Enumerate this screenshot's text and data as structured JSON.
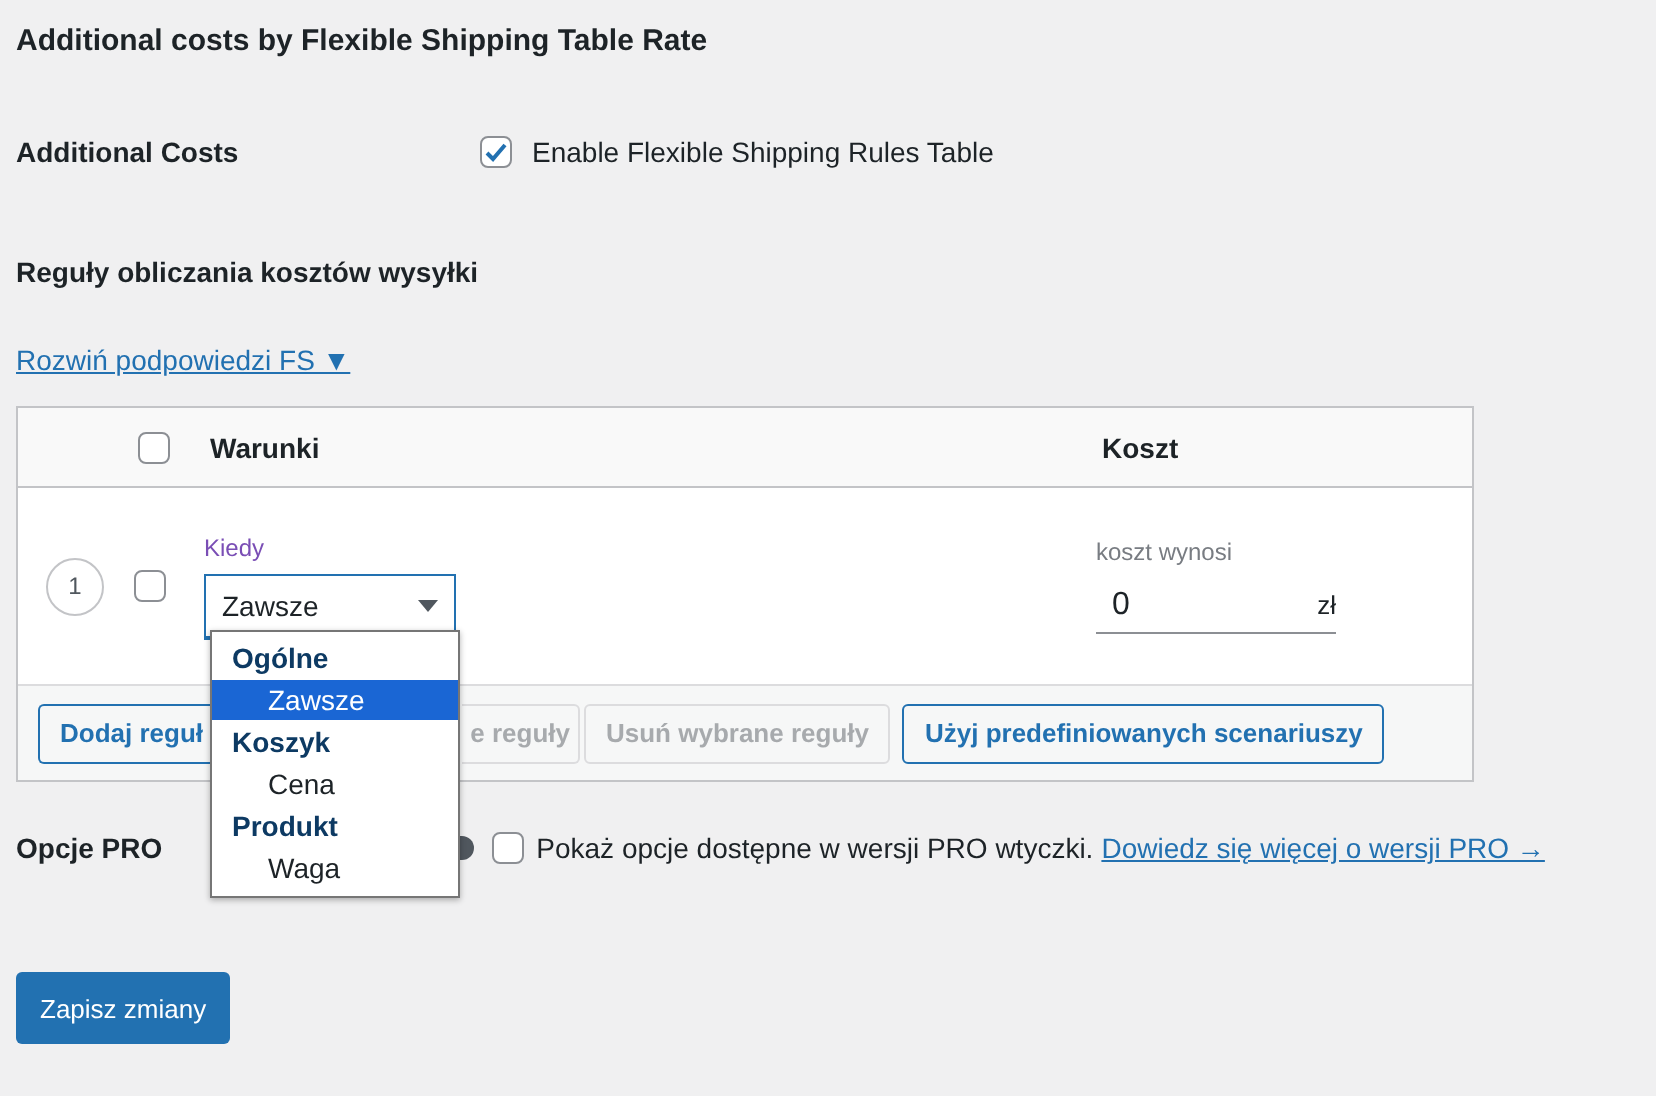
{
  "title": "Additional costs by Flexible Shipping Table Rate",
  "additional_costs": {
    "label": "Additional Costs",
    "checkbox": {
      "label": "Enable Flexible Shipping Rules Table",
      "checked": true
    }
  },
  "rules_heading": "Reguły obliczania kosztów wysyłki",
  "hints_link": "Rozwiń podpowiedzi FS ▼",
  "table": {
    "header_checked": false,
    "columns": [
      "Warunki",
      "Koszt"
    ],
    "rows": [
      {
        "number": "1",
        "checked": false,
        "condition_label": "Kiedy",
        "condition_value": "Zawsze",
        "cost_label": "koszt wynosi",
        "cost_value": "0",
        "currency": "zł"
      }
    ],
    "buttons": [
      {
        "label": "Dodaj reguł",
        "disabled": false
      },
      {
        "label": "e reguły",
        "disabled": true
      },
      {
        "label": "Usuń wybrane reguły",
        "disabled": true
      },
      {
        "label": "Użyj predefiniowanych scenariuszy",
        "disabled": false
      }
    ]
  },
  "dropdown": {
    "groups": [
      {
        "label": "Ogólne",
        "options": [
          {
            "label": "Zawsze",
            "selected": true
          }
        ]
      },
      {
        "label": "Koszyk",
        "options": [
          {
            "label": "Cena",
            "selected": false
          }
        ]
      },
      {
        "label": "Produkt",
        "options": [
          {
            "label": "Waga",
            "selected": false
          }
        ]
      }
    ]
  },
  "pro": {
    "label": "Opcje PRO",
    "checkbox": {
      "label": "Pokaż opcje dostępne w wersji PRO wtyczki.",
      "checked": false
    },
    "link": "Dowiedz się więcej o wersji PRO →"
  },
  "save_button": "Zapisz zmiany"
}
